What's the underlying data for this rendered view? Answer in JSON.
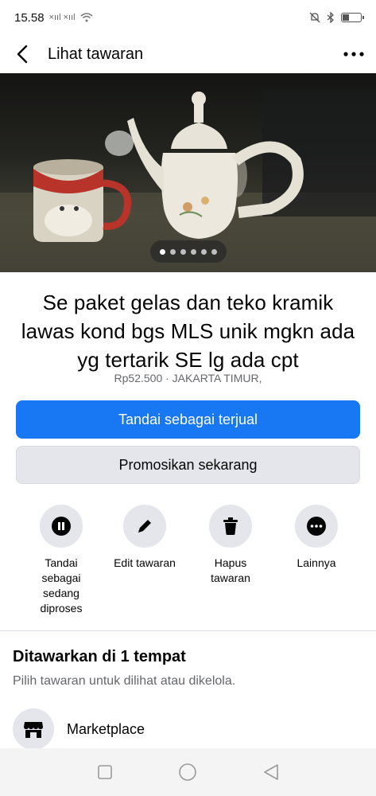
{
  "status_bar": {
    "time": "15.58",
    "signal_icons": "×ııl ×ııl",
    "icons": [
      "mute-icon",
      "bluetooth-icon",
      "battery-icon"
    ]
  },
  "header": {
    "title": "Lihat tawaran",
    "back_icon": "chevron-left-icon",
    "more_icon": "more-dots-icon"
  },
  "gallery": {
    "photo_count": 6,
    "active_index": 0
  },
  "listing": {
    "title": "Se paket gelas dan teko kramik lawas kond bgs MLS unik mgkn ada yg tertarik SE lg ada cpt",
    "meta": "Rp52.500 · JAKARTA TIMUR,"
  },
  "buttons": {
    "mark_sold": "Tandai sebagai terjual",
    "promote": "Promosikan sekarang"
  },
  "actions": [
    {
      "label": "Tandai\nsebagai\nsedang\ndiproses",
      "icon": "pause-icon"
    },
    {
      "label": "Edit tawaran",
      "icon": "pencil-icon"
    },
    {
      "label": "Hapus\ntawaran",
      "icon": "trash-icon"
    },
    {
      "label": "Lainnya",
      "icon": "more-dots-icon"
    }
  ],
  "offered_section": {
    "title": "Ditawarkan di 1 tempat",
    "subtitle": "Pilih tawaran untuk dilihat atau dikelola.",
    "places": [
      {
        "label": "Marketplace",
        "icon": "marketplace-shop-icon"
      }
    ]
  },
  "nav_bar": {
    "buttons": [
      "recent-apps-icon",
      "home-icon",
      "back-triangle-icon"
    ]
  },
  "colors": {
    "primary": "#1877f2",
    "secondary_bg": "#e4e6eb",
    "muted_text": "#65676b"
  }
}
